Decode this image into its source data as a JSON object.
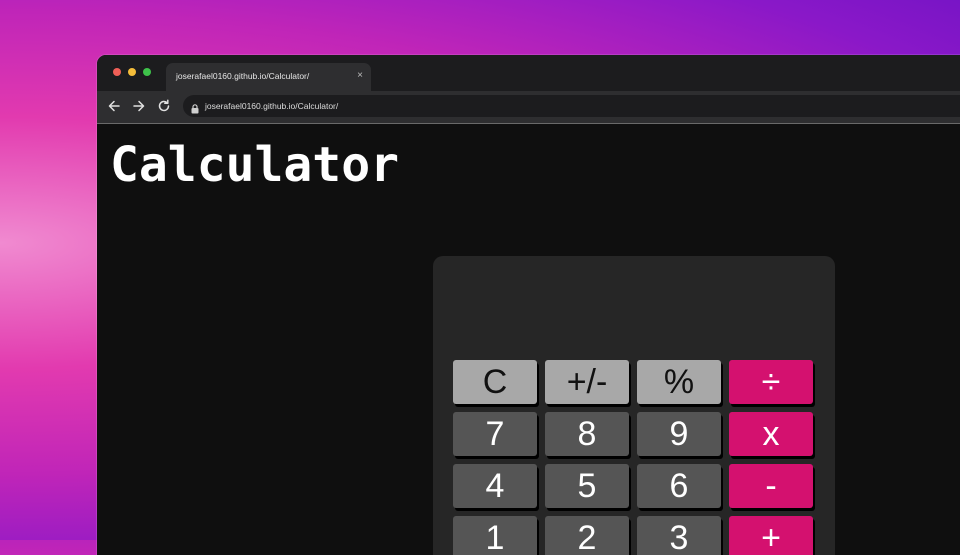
{
  "browser": {
    "tab_title": "joserafael0160.github.io/Calculator/",
    "tab_close": "×",
    "url": "joserafael0160.github.io/Calculator/",
    "icons": [
      "back-arrow-icon",
      "forward-arrow-icon",
      "reload-icon",
      "lock-icon",
      "close-icon"
    ]
  },
  "page": {
    "title": "Calculator"
  },
  "calculator": {
    "display_value": "",
    "keys": [
      {
        "label": "C",
        "kind": "func"
      },
      {
        "label": "+/-",
        "kind": "func"
      },
      {
        "label": "%",
        "kind": "func"
      },
      {
        "label": "÷",
        "kind": "op"
      },
      {
        "label": "7",
        "kind": "num"
      },
      {
        "label": "8",
        "kind": "num"
      },
      {
        "label": "9",
        "kind": "num"
      },
      {
        "label": "x",
        "kind": "op"
      },
      {
        "label": "4",
        "kind": "num"
      },
      {
        "label": "5",
        "kind": "num"
      },
      {
        "label": "6",
        "kind": "num"
      },
      {
        "label": "-",
        "kind": "op"
      },
      {
        "label": "1",
        "kind": "num"
      },
      {
        "label": "2",
        "kind": "num"
      },
      {
        "label": "3",
        "kind": "num"
      },
      {
        "label": "+",
        "kind": "op"
      }
    ]
  },
  "colors": {
    "operator_key": "#d4116f",
    "function_key": "#a8a8a8",
    "number_key": "#555555",
    "calculator_body": "#262626",
    "page_background": "#0f0f0f"
  }
}
